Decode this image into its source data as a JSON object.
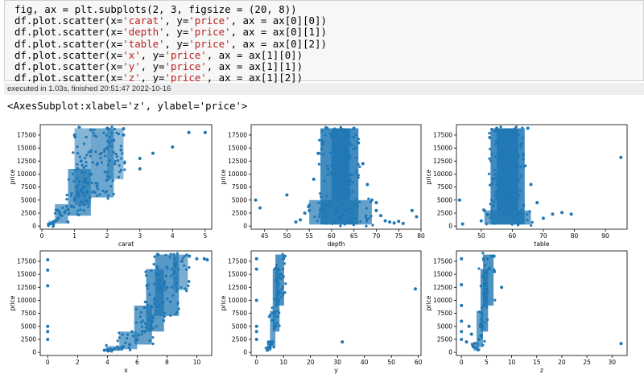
{
  "code": {
    "lines": [
      [
        {
          "t": "fig, ax = plt.subplots(2, 3, figsize = (20, 8))",
          "c": ""
        }
      ],
      [
        {
          "t": "df.plot.scatter(x=",
          "c": ""
        },
        {
          "t": "'carat'",
          "c": "str"
        },
        {
          "t": ", y=",
          "c": ""
        },
        {
          "t": "'price'",
          "c": "str"
        },
        {
          "t": ", ax = ax[0][0])",
          "c": ""
        }
      ],
      [
        {
          "t": "df.plot.scatter(x=",
          "c": ""
        },
        {
          "t": "'depth'",
          "c": "str"
        },
        {
          "t": ", y=",
          "c": ""
        },
        {
          "t": "'price'",
          "c": "str"
        },
        {
          "t": ", ax = ax[0][1])",
          "c": ""
        }
      ],
      [
        {
          "t": "df.plot.scatter(x=",
          "c": ""
        },
        {
          "t": "'table'",
          "c": "str"
        },
        {
          "t": ", y=",
          "c": ""
        },
        {
          "t": "'price'",
          "c": "str"
        },
        {
          "t": ", ax = ax[0][2])",
          "c": ""
        }
      ],
      [
        {
          "t": "df.plot.scatter(x=",
          "c": ""
        },
        {
          "t": "'x'",
          "c": "str"
        },
        {
          "t": ", y=",
          "c": ""
        },
        {
          "t": "'price'",
          "c": "str"
        },
        {
          "t": ", ax = ax[1][0])",
          "c": ""
        }
      ],
      [
        {
          "t": "df.plot.scatter(x=",
          "c": ""
        },
        {
          "t": "'y'",
          "c": "str"
        },
        {
          "t": ", y=",
          "c": ""
        },
        {
          "t": "'price'",
          "c": "str"
        },
        {
          "t": ", ax = ax[1][1])",
          "c": ""
        }
      ],
      [
        {
          "t": "df.plot.scatter(x=",
          "c": ""
        },
        {
          "t": "'z'",
          "c": "str"
        },
        {
          "t": ", y=",
          "c": ""
        },
        {
          "t": "'price'",
          "c": "str"
        },
        {
          "t": ", ax = ax[1][2])",
          "c": ""
        }
      ]
    ]
  },
  "execution": {
    "text": "executed in 1.03s, finished 20:51:47 2022-10-16"
  },
  "output": {
    "repr": "<AxesSubplot:xlabel='z', ylabel='price'>"
  },
  "colors": {
    "point": "#1f77b4",
    "string": "#ba2121"
  },
  "chart_data": [
    {
      "type": "scatter",
      "xlabel": "carat",
      "ylabel": "price",
      "xlim": [
        -0.05,
        5.2
      ],
      "ylim": [
        -600,
        19500
      ],
      "xticks": [
        0,
        1,
        2,
        3,
        4,
        5
      ],
      "yticks": [
        0,
        2500,
        5000,
        7500,
        10000,
        12500,
        15000,
        17500
      ],
      "x": [
        0.2,
        0.25,
        0.3,
        0.35,
        0.4,
        0.5,
        0.6,
        0.7,
        0.8,
        0.9,
        1.0,
        1.1,
        1.2,
        1.5,
        1.7,
        2.0,
        2.2,
        2.5,
        3.0,
        3.0,
        3.4,
        4.0,
        4.5,
        5.0,
        1.0,
        1.5,
        2.0,
        2.5,
        1.2,
        0.5
      ],
      "y": [
        350,
        450,
        500,
        700,
        900,
        1500,
        2000,
        2600,
        3200,
        3800,
        5000,
        6000,
        7000,
        10000,
        12000,
        15000,
        16500,
        17500,
        11000,
        13000,
        14000,
        15200,
        18000,
        18000,
        17500,
        18500,
        18800,
        18700,
        12500,
        3000
      ],
      "draw": {
        "bands": [
          [
            0.2,
            200,
            0.4,
            1000,
            0.55
          ],
          [
            0.4,
            500,
            0.8,
            4200,
            0.65
          ],
          [
            0.8,
            2000,
            1.5,
            11000,
            0.7
          ],
          [
            1.0,
            4000,
            1.5,
            18800,
            0.55
          ],
          [
            1.5,
            5500,
            2.2,
            18800,
            0.65
          ],
          [
            2.0,
            9000,
            2.5,
            18800,
            0.5
          ]
        ]
      }
    },
    {
      "type": "scatter",
      "xlabel": "depth",
      "ylabel": "price",
      "xlim": [
        42,
        80
      ],
      "ylim": [
        -600,
        19500
      ],
      "xticks": [
        45,
        50,
        55,
        60,
        65,
        70,
        75,
        80
      ],
      "yticks": [
        0,
        2500,
        5000,
        7500,
        10000,
        12500,
        15000,
        17500
      ],
      "x": [
        43,
        44,
        50,
        52,
        53,
        54,
        55,
        56,
        57,
        58,
        66,
        67,
        68,
        69,
        70,
        71,
        72,
        73,
        74,
        75,
        76,
        78,
        79,
        59,
        65,
        55,
        70
      ],
      "y": [
        5000,
        3500,
        6000,
        800,
        1200,
        2500,
        4000,
        9000,
        14000,
        16000,
        16000,
        12000,
        8000,
        5000,
        3000,
        2000,
        1000,
        800,
        600,
        900,
        500,
        3000,
        1800,
        18800,
        18800,
        3000,
        4500
      ],
      "draw": {
        "bands": [
          [
            57.5,
            300,
            66,
            18800,
            0.85
          ],
          [
            55,
            300,
            69,
            5000,
            0.7
          ],
          [
            60,
            5000,
            64,
            18800,
            0.9
          ]
        ]
      }
    },
    {
      "type": "scatter",
      "xlabel": "table",
      "ylabel": "price",
      "xlim": [
        42,
        97
      ],
      "ylim": [
        -600,
        19500
      ],
      "xticks": [
        50,
        60,
        70,
        80,
        90
      ],
      "yticks": [
        0,
        2500,
        5000,
        7500,
        10000,
        12500,
        15000,
        17500
      ],
      "x": [
        43,
        44,
        50,
        51,
        52,
        66,
        68,
        70,
        73,
        76,
        79,
        95,
        55,
        65
      ],
      "y": [
        5000,
        400,
        1000,
        3000,
        2200,
        8000,
        4500,
        1500,
        2300,
        2600,
        2300,
        13200,
        18800,
        18800
      ],
      "draw": {
        "bands": [
          [
            53,
            300,
            64,
            18800,
            0.85
          ],
          [
            51,
            300,
            66,
            3000,
            0.7
          ],
          [
            55,
            3000,
            62,
            18800,
            0.9
          ]
        ]
      }
    },
    {
      "type": "scatter",
      "xlabel": "x",
      "ylabel": "price",
      "xlim": [
        -0.5,
        11
      ],
      "ylim": [
        -600,
        19500
      ],
      "xticks": [
        0,
        2,
        4,
        6,
        8,
        10
      ],
      "yticks": [
        0,
        2500,
        5000,
        7500,
        10000,
        12500,
        15000,
        17500
      ],
      "x": [
        0,
        0,
        0,
        0,
        0,
        0,
        3.8,
        4.0,
        4.2,
        4.5,
        5.0,
        5.5,
        6.0,
        6.5,
        7.0,
        7.5,
        8.0,
        8.5,
        9.0,
        9.5,
        10.0,
        10.5,
        10.7
      ],
      "y": [
        2500,
        4000,
        5000,
        12800,
        15800,
        17800,
        400,
        500,
        600,
        700,
        1000,
        1500,
        2500,
        4000,
        6000,
        9000,
        12500,
        15500,
        17500,
        18500,
        18000,
        18000,
        17800
      ],
      "draw": {
        "bands": [
          [
            3.9,
            300,
            5.0,
            1200,
            0.6
          ],
          [
            4.8,
            600,
            6.0,
            4000,
            0.65
          ],
          [
            5.8,
            1500,
            7.0,
            9000,
            0.7
          ],
          [
            6.6,
            4000,
            7.8,
            16000,
            0.75
          ],
          [
            7.2,
            7000,
            8.8,
            18800,
            0.75
          ],
          [
            8.4,
            12000,
            9.4,
            18800,
            0.6
          ]
        ]
      }
    },
    {
      "type": "scatter",
      "xlabel": "y",
      "ylabel": "price",
      "xlim": [
        -2,
        61
      ],
      "ylim": [
        -600,
        19500
      ],
      "xticks": [
        0,
        10,
        20,
        30,
        40,
        50,
        60
      ],
      "yticks": [
        0,
        2500,
        5000,
        7500,
        10000,
        12500,
        15000,
        17500
      ],
      "x": [
        0,
        0,
        0,
        0,
        0,
        0,
        4,
        5,
        6,
        7,
        8,
        9,
        10,
        10.5,
        31.8,
        58.9
      ],
      "y": [
        2500,
        4000,
        5000,
        10000,
        16000,
        18000,
        400,
        800,
        2000,
        5000,
        10000,
        15000,
        18000,
        18500,
        2000,
        12200
      ],
      "draw": {
        "bands": [
          [
            3.8,
            300,
            5.5,
            2000,
            0.6
          ],
          [
            5.0,
            1000,
            7.0,
            8000,
            0.7
          ],
          [
            6.0,
            4000,
            8.5,
            16000,
            0.8
          ],
          [
            7.0,
            9000,
            10.2,
            18800,
            0.8
          ]
        ]
      }
    },
    {
      "type": "scatter",
      "xlabel": "z",
      "ylabel": "price",
      "xlim": [
        -1,
        33
      ],
      "ylim": [
        -600,
        19500
      ],
      "xticks": [
        0,
        5,
        10,
        15,
        20,
        25,
        30
      ],
      "yticks": [
        0,
        2500,
        5000,
        7500,
        10000,
        12500,
        15000,
        17500
      ],
      "x": [
        0,
        0,
        0,
        0,
        0,
        0,
        1,
        1.5,
        2.0,
        2.5,
        3.0,
        3.5,
        4.0,
        4.5,
        5.0,
        5.5,
        6.0,
        6.5,
        8.0,
        31.8
      ],
      "y": [
        2500,
        4000,
        6000,
        9000,
        13000,
        18000,
        2000,
        5000,
        3500,
        1000,
        800,
        2500,
        5000,
        9000,
        13000,
        16000,
        18500,
        18500,
        12500,
        1700
      ],
      "draw": {
        "bands": [
          [
            2.4,
            300,
            3.5,
            2000,
            0.6
          ],
          [
            3.0,
            1000,
            4.3,
            8000,
            0.7
          ],
          [
            3.8,
            4000,
            5.3,
            16000,
            0.8
          ],
          [
            4.3,
            9000,
            6.4,
            18800,
            0.8
          ]
        ]
      }
    }
  ]
}
